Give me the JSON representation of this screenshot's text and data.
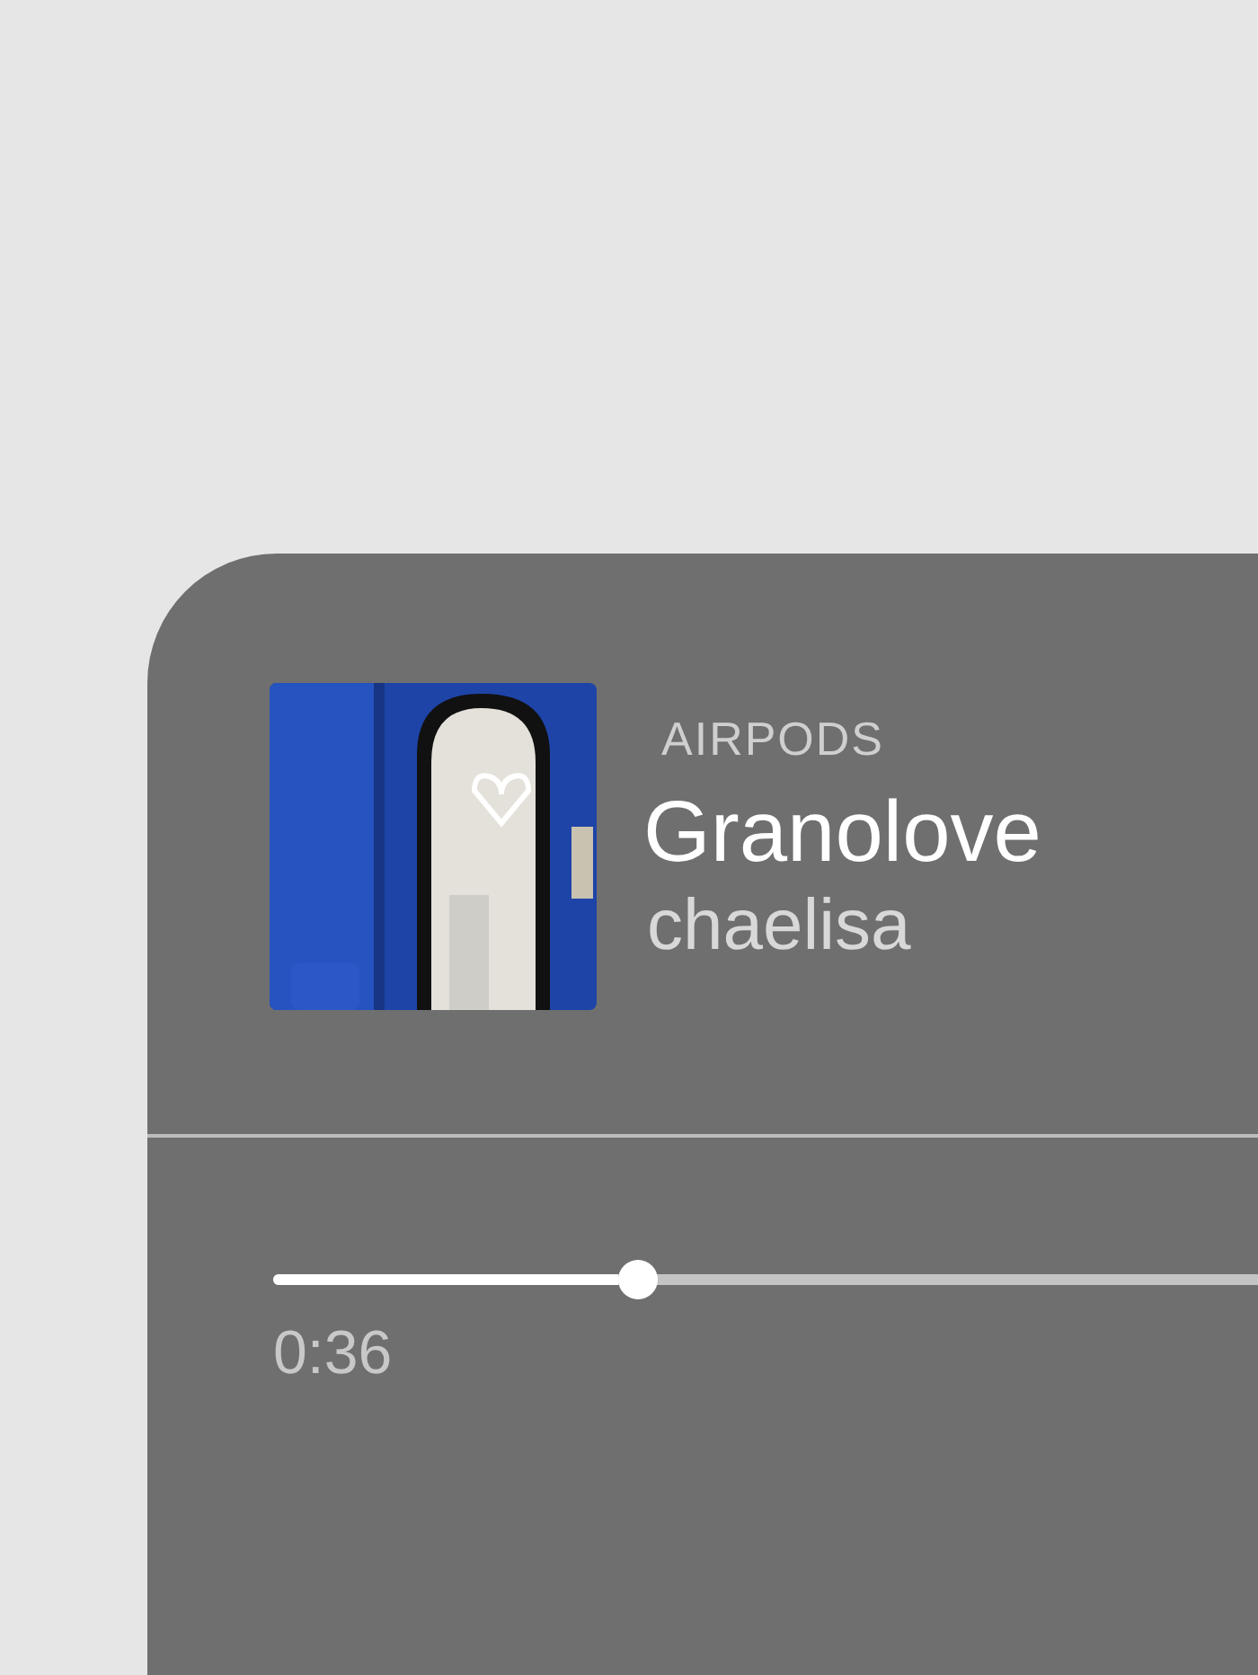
{
  "now_playing": {
    "device": "AIRPODS",
    "title": "Granolove",
    "artist": "chaelisa"
  },
  "scrubber": {
    "level": 0.37,
    "elapsed": "0:36"
  }
}
